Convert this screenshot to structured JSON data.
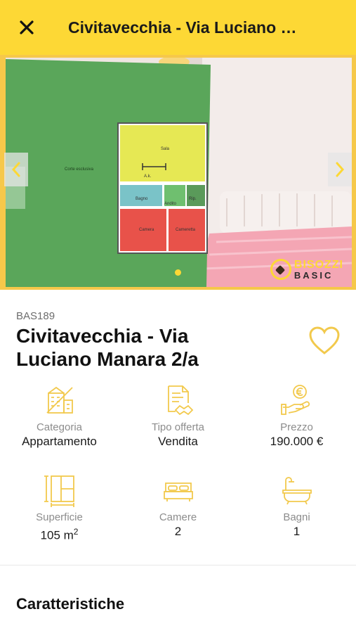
{
  "header": {
    "title": "Civitavecchia - Via Luciano …"
  },
  "gallery": {
    "floorplan_labels": {
      "corte": "Corte esclusiva",
      "sala": "Sala",
      "ak": "A.k.",
      "bagno": "Bagno",
      "andito": "Andito",
      "rip": "Rip.",
      "camera": "Camera",
      "cameretta": "Cameretta"
    },
    "logo_top": "BISOZZI",
    "logo_bottom": "BASIC",
    "active_slide": 1,
    "total_dots": 1
  },
  "listing": {
    "code": "BAS189",
    "title_line1": "Civitavecchia - Via",
    "title_line2": "Luciano Manara 2/a"
  },
  "features": [
    {
      "label": "Categoria",
      "value": "Appartamento",
      "icon": "building-icon"
    },
    {
      "label": "Tipo offerta",
      "value": "Vendita",
      "icon": "contract-handshake-icon"
    },
    {
      "label": "Prezzo",
      "value": "190.000 €",
      "icon": "euro-hand-icon"
    },
    {
      "label": "Superficie",
      "value": "105 m",
      "value_sup": "2",
      "icon": "floor-plan-icon"
    },
    {
      "label": "Camere",
      "value": "2",
      "icon": "bed-icon"
    },
    {
      "label": "Bagni",
      "value": "1",
      "icon": "bathtub-icon"
    }
  ],
  "sections": {
    "characteristics_title": "Caratteristiche"
  },
  "colors": {
    "accent": "#fdd835",
    "icon_yellow": "#f2c94c"
  }
}
